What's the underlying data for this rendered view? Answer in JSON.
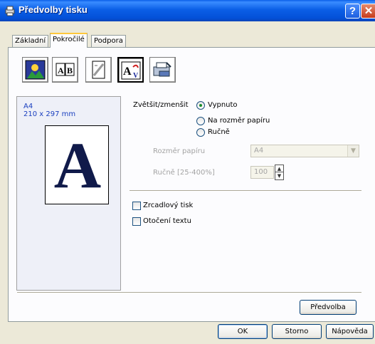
{
  "window": {
    "title": "Předvolby tisku"
  },
  "tabs": [
    {
      "label": "Základní"
    },
    {
      "label": "Pokročilé"
    },
    {
      "label": "Podpora"
    }
  ],
  "toolbar": {
    "icons": [
      "color-quality-icon",
      "duplex-icon",
      "watermark-icon",
      "scaling-icon",
      "device-settings-icon"
    ],
    "selected_index": 3
  },
  "preview": {
    "paper_name": "A4",
    "paper_dims": "210 x 297 mm",
    "letter": "A"
  },
  "scaling": {
    "label": "Zvětšit/zmenšit",
    "options": [
      "Vypnuto",
      "Na rozměr papíru",
      "Ručně"
    ],
    "selected": 0,
    "paper_size_label": "Rozměr papíru",
    "paper_size_value": "A4",
    "manual_label": "Ručně [25-400%]",
    "manual_value": "100"
  },
  "options": {
    "mirror_print": "Zrcadlový tisk",
    "reverse_print": "Otočení textu"
  },
  "buttons": {
    "default": "Předvolba",
    "ok": "OK",
    "cancel": "Storno",
    "help": "Nápověda"
  },
  "colors": {
    "titlebar": "#0b5fe6",
    "tab_highlight": "#ffc83c",
    "preview_text": "#1a3fbf"
  }
}
